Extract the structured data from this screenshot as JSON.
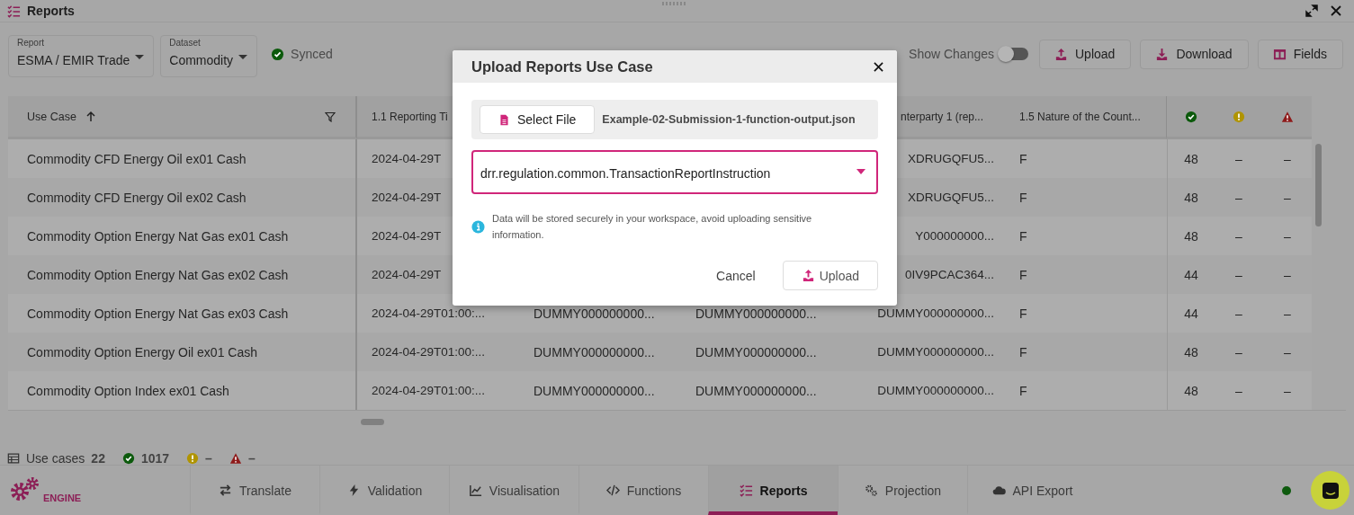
{
  "window": {
    "title": "Reports"
  },
  "toolbar": {
    "report": {
      "label": "Report",
      "value": "ESMA / EMIR Trade"
    },
    "dataset": {
      "label": "Dataset",
      "value": "Commodity"
    },
    "sync_status": "Synced",
    "show_changes": {
      "label": "Show Changes",
      "on": false
    },
    "buttons": [
      {
        "label": "Upload"
      },
      {
        "label": "Download"
      },
      {
        "label": "Fields"
      }
    ]
  },
  "table": {
    "headers": {
      "use_case": "Use Case",
      "use_case_sorted": true,
      "column_2": "1.1 Reporting Ti",
      "column_5": "nterparty 1 (rep...",
      "column_6": "1.5 Nature of the Count..."
    },
    "rows": [
      {
        "use_case": "Commodity CFD Energy Oil ex01 Cash",
        "column_2": "2024-04-29T",
        "column_5": "XDRUGQFU5...",
        "column_6": "F",
        "passed": "48",
        "warnings": "–",
        "errors": "–"
      },
      {
        "use_case": "Commodity CFD Energy Oil ex02 Cash",
        "column_2": "2024-04-29T",
        "column_5": "XDRUGQFU5...",
        "column_6": "F",
        "passed": "48",
        "warnings": "–",
        "errors": "–"
      },
      {
        "use_case": "Commodity Option Energy Nat Gas ex01 Cash",
        "column_2": "2024-04-29T",
        "column_5": "Y000000000...",
        "column_6": "F",
        "passed": "48",
        "warnings": "–",
        "errors": "–"
      },
      {
        "use_case": "Commodity Option Energy Nat Gas ex02 Cash",
        "column_2": "2024-04-29T",
        "column_5": "0IV9PCAC364...",
        "column_6": "F",
        "passed": "44",
        "warnings": "–",
        "errors": "–"
      },
      {
        "use_case": "Commodity Option Energy Nat Gas ex03 Cash",
        "column_2": "2024-04-29T01:00:...",
        "column_3": "DUMMY000000000...",
        "column_4": "DUMMY000000000...",
        "column_5": "DUMMY000000000...",
        "column_6": "F",
        "passed": "44",
        "warnings": "–",
        "errors": "–"
      },
      {
        "use_case": "Commodity Option Energy Oil ex01 Cash",
        "column_2": "2024-04-29T01:00:...",
        "column_3": "DUMMY000000000...",
        "column_4": "DUMMY000000000...",
        "column_5": "DUMMY000000000...",
        "column_6": "F",
        "passed": "48",
        "warnings": "–",
        "errors": "–"
      },
      {
        "use_case": "Commodity Option Index ex01 Cash",
        "column_2": "2024-04-29T01:00:...",
        "column_3": "DUMMY000000000...",
        "column_4": "DUMMY000000000...",
        "column_5": "DUMMY000000000...",
        "column_6": "F",
        "passed": "48",
        "warnings": "–",
        "errors": "–"
      }
    ]
  },
  "summary": {
    "use_cases_label": "Use cases",
    "use_cases": "22",
    "passed": "1017",
    "warnings": "–",
    "errors": "–"
  },
  "nav": {
    "logo_text": "ENGINE",
    "connected": true,
    "tabs": [
      {
        "label": "Translate",
        "selected": false
      },
      {
        "label": "Validation",
        "selected": false
      },
      {
        "label": "Visualisation",
        "selected": false
      },
      {
        "label": "Functions",
        "selected": false
      },
      {
        "label": "Reports",
        "selected": true
      },
      {
        "label": "Projection",
        "selected": false
      },
      {
        "label": "API Export",
        "selected": false
      }
    ]
  },
  "modal": {
    "title": "Upload Reports Use Case",
    "select_file": "Select File",
    "file_name": "Example-02-Submission-1-function-output.json",
    "type_value": "drr.regulation.common.TransactionReportInstruction",
    "info": "Data will be stored securely in your workspace, avoid uploading sensitive information.",
    "cancel": "Cancel",
    "upload": "Upload"
  }
}
